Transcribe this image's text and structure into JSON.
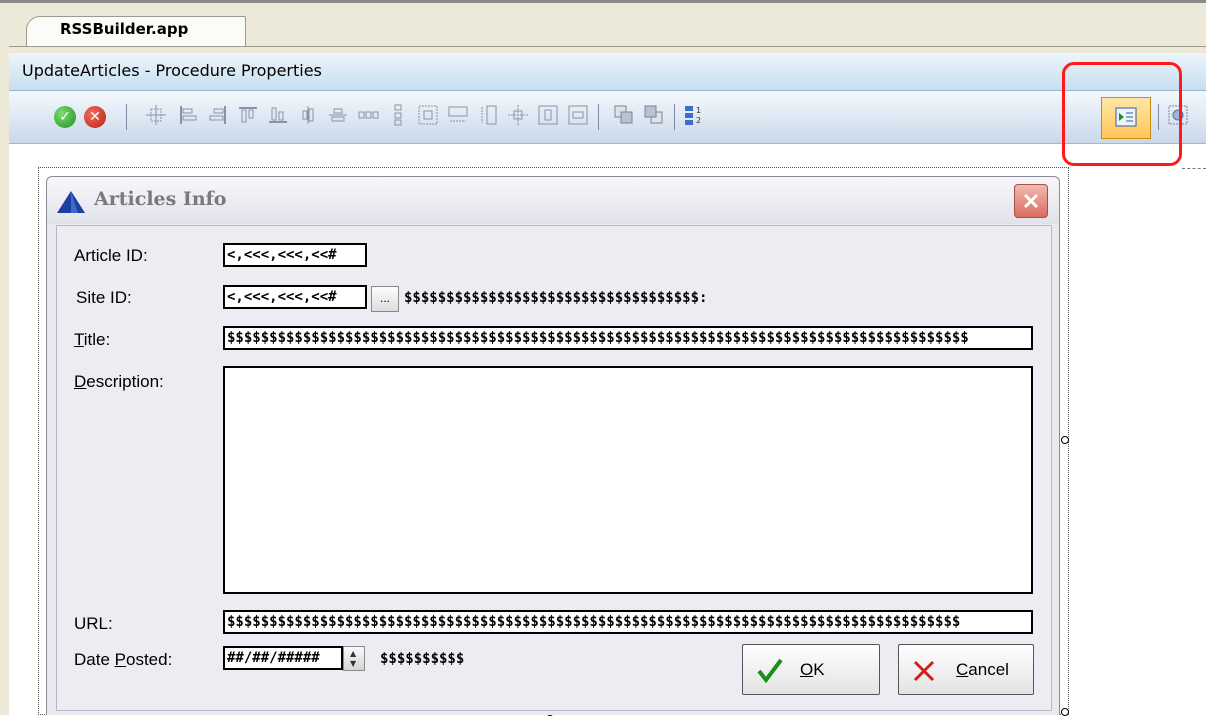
{
  "tab": {
    "label": "RSSBuilder.app"
  },
  "window_title": "UpdateArticles - Procedure Properties",
  "toolbar": {
    "ok_icon": "ok-check-icon",
    "cancel_icon": "cancel-x-icon",
    "icons": [
      "align-center-icon",
      "align-left-icon",
      "align-right-icon",
      "align-top-icon",
      "align-bottom-icon",
      "center-horizontal-icon",
      "center-vertical-icon",
      "space-horizontal-icon",
      "space-vertical-icon",
      "same-size-icon",
      "same-width-icon",
      "same-height-icon",
      "center-in-window-icon",
      "center-horizontal-window-icon",
      "center-vertical-window-icon",
      "bring-to-front-icon",
      "send-to-back-icon",
      "tab-order-icon",
      "preview-icon",
      "extra-icon"
    ],
    "highlighted_icon": "preview-icon",
    "highlight_color": "#ff1a1a"
  },
  "dialog": {
    "title": "Articles Info",
    "fields": {
      "article_id": {
        "label": "Article ID:",
        "value": "<,<<<,<<<,<<#"
      },
      "site_id": {
        "label": "Site ID:",
        "value": "<,<<<,<<<,<<#",
        "lookup_label": "...",
        "display": "$$$$$$$$$$$$$$$$$$$$$$$$$$$$$$$$$$$:"
      },
      "title": {
        "label_rest": "itle:",
        "label_accel": "T",
        "value": "$$$$$$$$$$$$$$$$$$$$$$$$$$$$$$$$$$$$$$$$$$$$$$$$$$$$$$$$$$$$$$$$$$$$$$$$$$$$$$$$$$$$$$$$"
      },
      "description": {
        "label_accel": "D",
        "label_rest": "escription:",
        "value": ""
      },
      "url": {
        "label": "URL:",
        "value": "$$$$$$$$$$$$$$$$$$$$$$$$$$$$$$$$$$$$$$$$$$$$$$$$$$$$$$$$$$$$$$$$$$$$$$$$$$$$$$$$$$$$$$$"
      },
      "date_posted": {
        "label_pre": "Date ",
        "label_accel": "P",
        "label_rest": "osted:",
        "value": "##/##/#####",
        "display": "$$$$$$$$$$"
      }
    },
    "ok_button": {
      "accel": "O",
      "rest": "K"
    },
    "cancel_button": {
      "accel": "C",
      "rest": "ancel"
    }
  }
}
